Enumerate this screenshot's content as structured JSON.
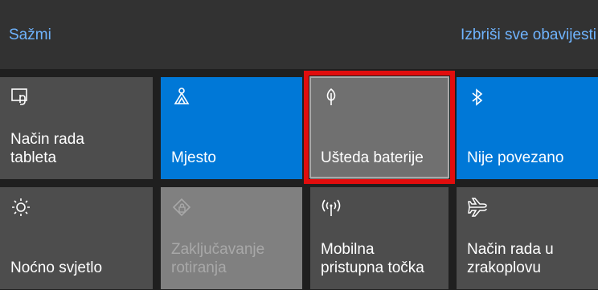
{
  "header": {
    "collapse_label": "Sažmi",
    "clear_all_label": "Izbriši sve obavijesti"
  },
  "tiles": [
    {
      "label": "Način rada\ntableta",
      "icon": "tablet-mode-icon",
      "state": "off"
    },
    {
      "label": "Mjesto",
      "icon": "location-icon",
      "state": "on"
    },
    {
      "label": "Ušteda baterije",
      "icon": "battery-saver-icon",
      "state": "off-highlighted"
    },
    {
      "label": "Nije povezano",
      "icon": "bluetooth-icon",
      "state": "on"
    },
    {
      "label": "Noćno svjetlo",
      "icon": "night-light-icon",
      "state": "off"
    },
    {
      "label": "Zaključavanje\nrotiranja",
      "icon": "rotation-lock-icon",
      "state": "disabled"
    },
    {
      "label": "Mobilna\npristupna točka",
      "icon": "mobile-hotspot-icon",
      "state": "off"
    },
    {
      "label": "Način rada u\nzrakoplovu",
      "icon": "airplane-mode-icon",
      "state": "off"
    }
  ],
  "colors": {
    "accent": "#0078d7",
    "tile_off": "#4d4d4d",
    "tile_disabled": "#808080",
    "link": "#6fb4ff",
    "highlight_border": "#e10d0d"
  }
}
